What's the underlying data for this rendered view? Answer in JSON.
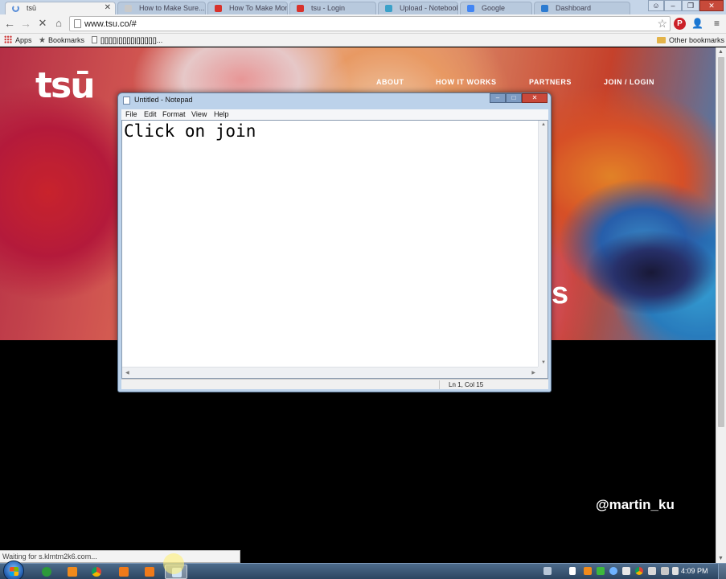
{
  "browser": {
    "active_tab": {
      "title": "tsū"
    },
    "background_tabs": [
      "How to Make Sure...",
      "How To Make Mon...",
      "tsu - Login",
      "Upload - Notebook",
      "Google",
      "Dashboard"
    ],
    "window_controls": {
      "minimize": "–",
      "maximize": "❐",
      "close": "✕"
    },
    "url": "www.tsu.co/#",
    "bookmarks": {
      "apps": "Apps",
      "bookmarks": "Bookmarks",
      "page": "[][][][]|[][][][]|[][][][][]...",
      "other": "Other bookmarks"
    },
    "status_bubble": "Waiting for s.klmtm2k6.com..."
  },
  "website": {
    "logo": "tsū",
    "nav": [
      "ABOUT",
      "HOW IT WORKS",
      "PARTNERS",
      "JOIN / LOGIN"
    ],
    "hero_partial_text": "s",
    "handle": "@martin_ku"
  },
  "notepad": {
    "title": "Untitled - Notepad",
    "menu": [
      "File",
      "Edit",
      "Format",
      "View",
      "Help"
    ],
    "content": "Click on join",
    "status_position": "Ln 1, Col 15"
  },
  "taskbar": {
    "clock": "4:09 PM"
  },
  "icons": {
    "back": "back-arrow-icon",
    "forward": "forward-arrow-icon",
    "stop": "stop-loading-icon",
    "home": "home-icon",
    "star": "bookmark-star-icon",
    "pinterest": "pinterest-icon",
    "user": "user-icon",
    "menu": "hamburger-menu-icon"
  },
  "colors": {
    "chrome_frame": "#c5d5e8",
    "notepad_frame": "#bcd2ea",
    "taskbar": "#3b5675"
  }
}
